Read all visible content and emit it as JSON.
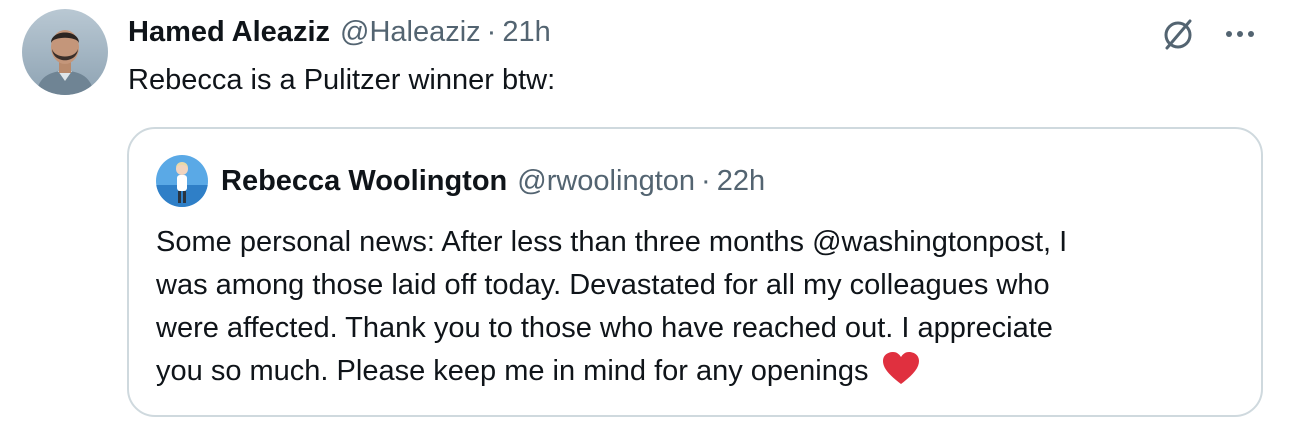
{
  "tweet": {
    "author_name": "Hamed Aleaziz",
    "author_handle": "@Haleaziz",
    "separator": "·",
    "time": "21h",
    "text": "Rebecca is a Pulitzer winner btw:",
    "actions": {
      "grok_icon": "grok-slash-circle-icon",
      "more_icon": "more-horizontal-icon"
    }
  },
  "quote": {
    "author_name": "Rebecca Woolington",
    "author_handle": "@rwoolington",
    "separator": "·",
    "time": "22h",
    "lines": [
      "Some personal news: After less than three months @washingtonpost, I",
      "was among those laid off today. Devastated for all my colleagues who",
      "were affected. Thank you to those who have reached out. I appreciate",
      "you so much. Please keep me in mind for any openings"
    ],
    "emoji": "red-heart-icon"
  },
  "colors": {
    "text_primary": "#0f1419",
    "text_secondary": "#536471",
    "border": "#cfd9de",
    "heart": "#e0303f"
  }
}
